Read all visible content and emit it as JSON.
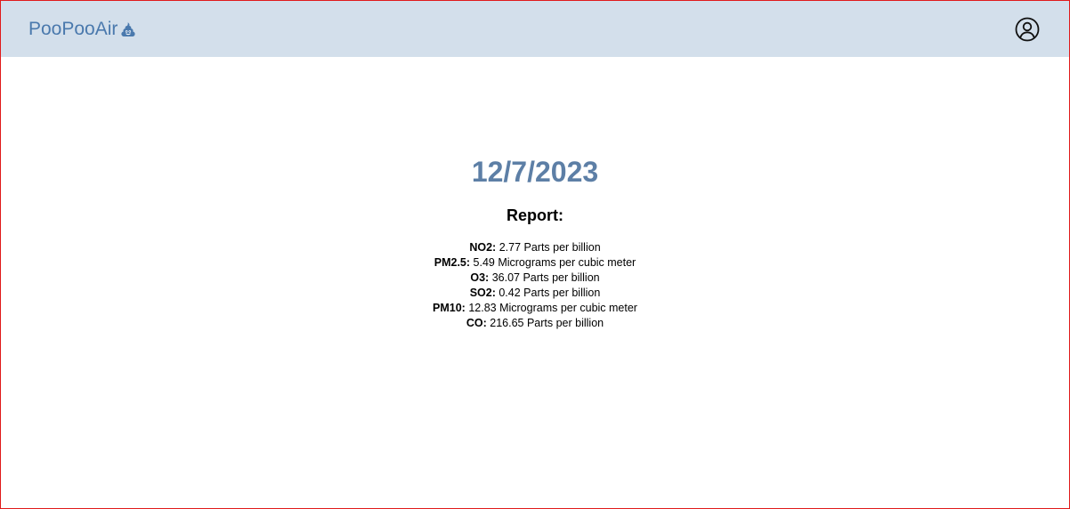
{
  "header": {
    "brand": "PooPooAir",
    "brand_icon": "poo-icon",
    "account_icon": "user-circle-icon",
    "background": "#d3dfeb",
    "brand_color": "#4a79ad"
  },
  "main": {
    "date": "12/7/2023",
    "date_color": "#5d7fa6",
    "report_heading": "Report:",
    "report": [
      {
        "label": "NO2:",
        "value": " 2.77 Parts per billion"
      },
      {
        "label": "PM2.5:",
        "value": " 5.49 Micrograms per cubic meter"
      },
      {
        "label": "O3:",
        "value": " 36.07 Parts per billion"
      },
      {
        "label": "SO2:",
        "value": " 0.42 Parts per billion"
      },
      {
        "label": "PM10:",
        "value": " 12.83 Micrograms per cubic meter"
      },
      {
        "label": "CO:",
        "value": " 216.65 Parts per billion"
      }
    ]
  }
}
